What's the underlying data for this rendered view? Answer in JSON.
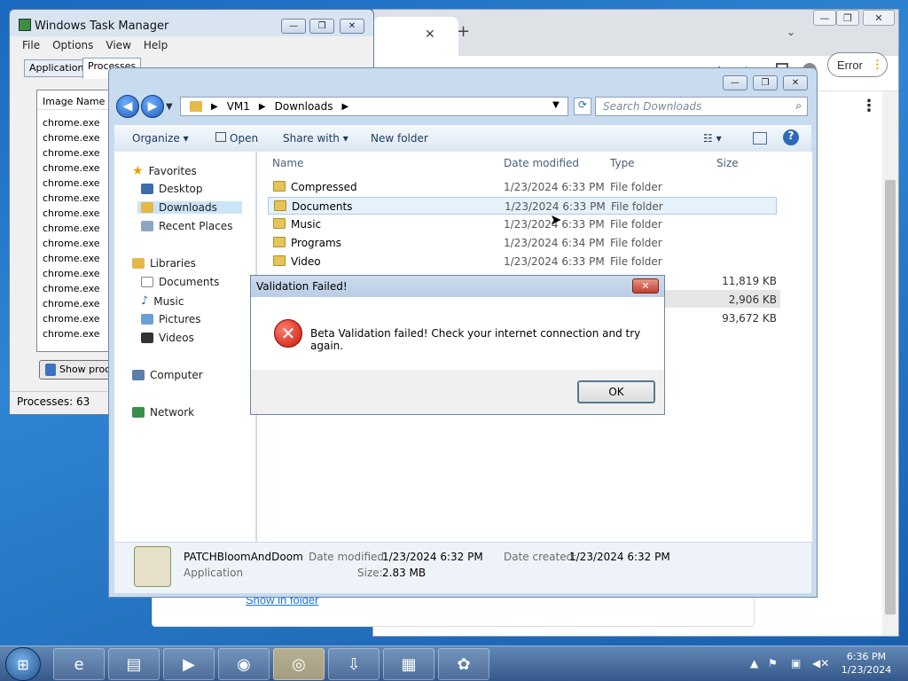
{
  "chrome": {
    "close_tab_glyph": "✕",
    "new_tab_glyph": "+",
    "error_label": "Error",
    "show_in_folder": "Show in folder",
    "menu_glyph": "⋮"
  },
  "taskmgr": {
    "title": "Windows Task Manager",
    "menu": [
      "File",
      "Options",
      "View",
      "Help"
    ],
    "tabs": [
      "Applications",
      "Processes"
    ],
    "list_header": "Image Name",
    "rows": [
      "chrome.exe",
      "chrome.exe",
      "chrome.exe",
      "chrome.exe",
      "chrome.exe",
      "chrome.exe",
      "chrome.exe",
      "chrome.exe",
      "chrome.exe",
      "chrome.exe",
      "chrome.exe",
      "chrome.exe",
      "chrome.exe",
      "chrome.exe",
      "chrome.exe"
    ],
    "show_processes": "Show proce",
    "status": "Processes: 63"
  },
  "explorer": {
    "breadcrumb": [
      "VM1",
      "Downloads"
    ],
    "search_placeholder": "Search Downloads",
    "commands": {
      "organize": "Organize",
      "open": "Open",
      "share": "Share with",
      "new_folder": "New folder"
    },
    "nav": {
      "favorites": "Favorites",
      "desktop": "Desktop",
      "downloads": "Downloads",
      "recent": "Recent Places",
      "libraries": "Libraries",
      "documents": "Documents",
      "music": "Music",
      "pictures": "Pictures",
      "videos": "Videos",
      "computer": "Computer",
      "network": "Network"
    },
    "columns": {
      "name": "Name",
      "date": "Date modified",
      "type": "Type",
      "size": "Size"
    },
    "files": [
      {
        "name": "Compressed",
        "date": "1/23/2024 6:33 PM",
        "type": "File folder"
      },
      {
        "name": "Documents",
        "date": "1/23/2024 6:33 PM",
        "type": "File folder"
      },
      {
        "name": "Music",
        "date": "1/23/2024 6:33 PM",
        "type": "File folder"
      },
      {
        "name": "Programs",
        "date": "1/23/2024 6:34 PM",
        "type": "File folder"
      },
      {
        "name": "Video",
        "date": "1/23/2024 6:33 PM",
        "type": "File folder"
      }
    ],
    "sizes": [
      "11,819 KB",
      "2,906 KB",
      "93,672 KB"
    ],
    "details": {
      "name": "PATCHBloomAndDoom",
      "kind": "Application",
      "date_modified_label": "Date modified:",
      "date_modified": "1/23/2024 6:32 PM",
      "date_created_label": "Date created:",
      "date_created": "1/23/2024 6:32 PM",
      "size_label": "Size:",
      "size": "2.83 MB"
    }
  },
  "dialog": {
    "title": "Validation Failed!",
    "message": "Beta Validation failed! Check your internet connection and try again.",
    "ok": "OK"
  },
  "taskbar": {
    "time": "6:36 PM",
    "date": "1/23/2024"
  }
}
